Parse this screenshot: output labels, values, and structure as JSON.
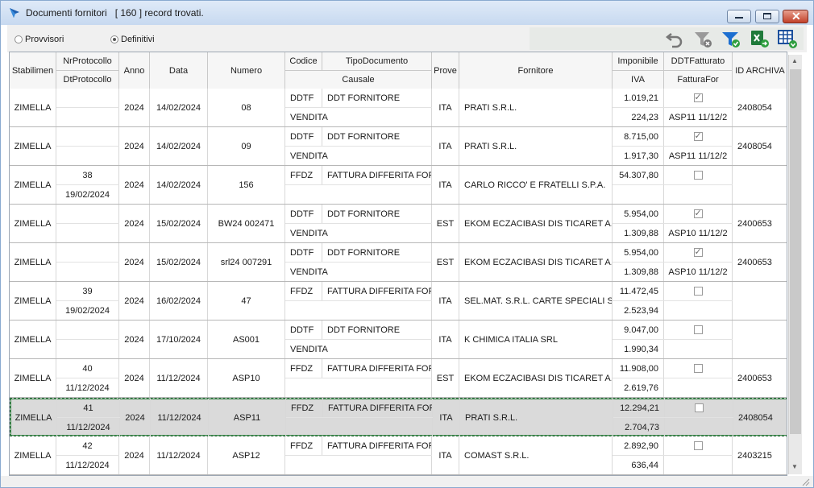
{
  "window": {
    "title": "Documenti fornitori   [ 160 ] record trovati.",
    "controls": {
      "minimize": "minimize",
      "maximize": "maximize",
      "close": "close"
    }
  },
  "filters": {
    "options": [
      {
        "label": "Provvisori",
        "selected": false
      },
      {
        "label": "Definitivi",
        "selected": true
      }
    ]
  },
  "toolbar": {
    "icons": [
      "undo-icon",
      "filter-clear-icon",
      "filter-apply-icon",
      "excel-export-icon",
      "grid-settings-icon"
    ]
  },
  "grid": {
    "headers": {
      "stabilimento": "Stabilimen",
      "nrprotocollo": "NrProtocollo",
      "dtprotocollo": "DtProtocollo",
      "anno": "Anno",
      "data": "Data",
      "numero": "Numero",
      "codice": "Codice",
      "tipodocumento": "TipoDocumento",
      "causale": "Causale",
      "prove": "Prove",
      "fornitore": "Fornitore",
      "imponibile": "Imponibile",
      "iva": "IVA",
      "ddtfatturato": "DDTFatturato",
      "fatturafor": "FatturaFor",
      "idarchiva": "ID ARCHIVA"
    },
    "rows": [
      {
        "stab": "ZIMELLA",
        "nrprot": "",
        "dtprot": "",
        "anno": "2024",
        "data": "14/02/2024",
        "numero": "08",
        "codice": "DDTF",
        "tipodoc": "DDT FORNITORE",
        "causale": "VENDITA",
        "prove": "ITA",
        "fornitore": "PRATI S.R.L.",
        "imponibile": "1.019,21",
        "iva": "224,23",
        "ddt": true,
        "fattfor": "ASP11 11/12/2",
        "idarch": "2408054",
        "selected": false
      },
      {
        "stab": "ZIMELLA",
        "nrprot": "",
        "dtprot": "",
        "anno": "2024",
        "data": "14/02/2024",
        "numero": "09",
        "codice": "DDTF",
        "tipodoc": "DDT FORNITORE",
        "causale": "VENDITA",
        "prove": "ITA",
        "fornitore": "PRATI S.R.L.",
        "imponibile": "8.715,00",
        "iva": "1.917,30",
        "ddt": true,
        "fattfor": "ASP11 11/12/2",
        "idarch": "2408054",
        "selected": false
      },
      {
        "stab": "ZIMELLA",
        "nrprot": "38",
        "dtprot": "19/02/2024",
        "anno": "2024",
        "data": "14/02/2024",
        "numero": "156",
        "codice": "FFDZ",
        "tipodoc": "FATTURA DIFFERITA FOR",
        "causale": "",
        "prove": "ITA",
        "fornitore": "CARLO RICCO' E FRATELLI S.P.A.",
        "imponibile": "54.307,80",
        "iva": "",
        "ddt": false,
        "fattfor": "",
        "idarch": "",
        "selected": false
      },
      {
        "stab": "ZIMELLA",
        "nrprot": "",
        "dtprot": "",
        "anno": "2024",
        "data": "15/02/2024",
        "numero": "BW24 002471",
        "codice": "DDTF",
        "tipodoc": "DDT FORNITORE",
        "causale": "VENDITA",
        "prove": "EST",
        "fornitore": "EKOM ECZACIBASI DIS TICARET A.S.",
        "imponibile": "5.954,00",
        "iva": "1.309,88",
        "ddt": true,
        "fattfor": "ASP10 11/12/2",
        "idarch": "2400653",
        "selected": false
      },
      {
        "stab": "ZIMELLA",
        "nrprot": "",
        "dtprot": "",
        "anno": "2024",
        "data": "15/02/2024",
        "numero": "srl24 007291",
        "codice": "DDTF",
        "tipodoc": "DDT FORNITORE",
        "causale": "VENDITA",
        "prove": "EST",
        "fornitore": "EKOM ECZACIBASI DIS TICARET A.S.",
        "imponibile": "5.954,00",
        "iva": "1.309,88",
        "ddt": true,
        "fattfor": "ASP10 11/12/2",
        "idarch": "2400653",
        "selected": false
      },
      {
        "stab": "ZIMELLA",
        "nrprot": "39",
        "dtprot": "19/02/2024",
        "anno": "2024",
        "data": "16/02/2024",
        "numero": "47",
        "codice": "FFDZ",
        "tipodoc": "FATTURA DIFFERITA FOR",
        "causale": "",
        "prove": "ITA",
        "fornitore": "SEL.MAT. S.R.L. CARTE SPECIALI SOC",
        "imponibile": "11.472,45",
        "iva": "2.523,94",
        "ddt": false,
        "fattfor": "",
        "idarch": "",
        "selected": false
      },
      {
        "stab": "ZIMELLA",
        "nrprot": "",
        "dtprot": "",
        "anno": "2024",
        "data": "17/10/2024",
        "numero": "AS001",
        "codice": "DDTF",
        "tipodoc": "DDT FORNITORE",
        "causale": "VENDITA",
        "prove": "ITA",
        "fornitore": "K CHIMICA ITALIA SRL",
        "imponibile": "9.047,00",
        "iva": "1.990,34",
        "ddt": false,
        "fattfor": "",
        "idarch": "",
        "selected": false
      },
      {
        "stab": "ZIMELLA",
        "nrprot": "40",
        "dtprot": "11/12/2024",
        "anno": "2024",
        "data": "11/12/2024",
        "numero": "ASP10",
        "codice": "FFDZ",
        "tipodoc": "FATTURA DIFFERITA FOR",
        "causale": "",
        "prove": "EST",
        "fornitore": "EKOM ECZACIBASI DIS TICARET A.S.",
        "imponibile": "11.908,00",
        "iva": "2.619,76",
        "ddt": false,
        "fattfor": "",
        "idarch": "2400653",
        "selected": false
      },
      {
        "stab": "ZIMELLA",
        "nrprot": "41",
        "dtprot": "11/12/2024",
        "anno": "2024",
        "data": "11/12/2024",
        "numero": "ASP11",
        "codice": "FFDZ",
        "tipodoc": "FATTURA DIFFERITA FOR",
        "causale": "",
        "prove": "ITA",
        "fornitore": "PRATI S.R.L.",
        "imponibile": "12.294,21",
        "iva": "2.704,73",
        "ddt": false,
        "fattfor": "",
        "idarch": "2408054",
        "selected": true
      },
      {
        "stab": "ZIMELLA",
        "nrprot": "42",
        "dtprot": "11/12/2024",
        "anno": "2024",
        "data": "11/12/2024",
        "numero": "ASP12",
        "codice": "FFDZ",
        "tipodoc": "FATTURA DIFFERITA FOR",
        "causale": "",
        "prove": "ITA",
        "fornitore": "COMAST S.R.L.",
        "imponibile": "2.892,90",
        "iva": "636,44",
        "ddt": false,
        "fattfor": "",
        "idarch": "2403215",
        "selected": false
      }
    ]
  },
  "colors": {
    "accent": "#2f6f3f",
    "titlebar": "#c7d9f0",
    "close": "#c2412a"
  }
}
